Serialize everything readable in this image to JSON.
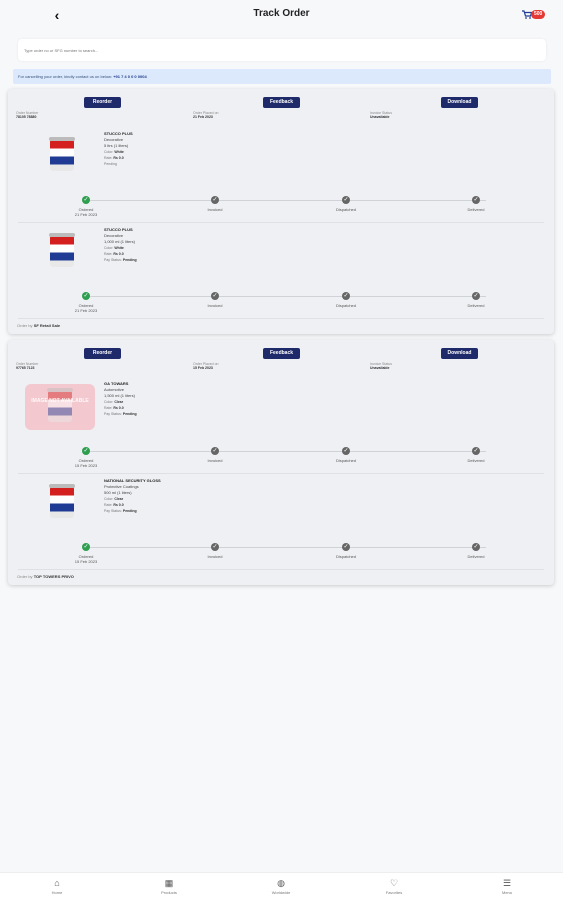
{
  "header": {
    "title": "Track Order",
    "back_icon": "chevron-left-icon",
    "cart_badge": "500"
  },
  "search": {
    "placeholder": "Type order no or SFG number to search..."
  },
  "notice": {
    "text": "For cancelling your order, kindly contact us on below:",
    "phone": "+91 7 4 0 0 0 0004"
  },
  "orders": [
    {
      "buttons": {
        "reorder": "Reorder",
        "feedback": "Feedback",
        "download": "Download"
      },
      "meta": [
        {
          "label": "Order Number",
          "value": "78105 78880"
        },
        {
          "label": "Order Placed on",
          "value": "21 Feb 2023"
        },
        {
          "label": "Invoice Status",
          "value": "Unavailable"
        }
      ],
      "items": [
        {
          "name": "STUCCO PLUS",
          "category": "Decorative",
          "qty": "5 ltrs (1 liters)",
          "color": "White",
          "rate": "Rs 0.0",
          "status_line": "Pending",
          "steps": [
            {
              "label": "Ordered",
              "date": "21 Feb 2023",
              "done": true
            },
            {
              "label": "Invoiced",
              "date": "",
              "done": false
            },
            {
              "label": "Dispatched",
              "date": "",
              "done": false
            },
            {
              "label": "Delivered",
              "date": "",
              "done": false
            }
          ]
        },
        {
          "name": "STUCCO PLUS",
          "category": "Decorative",
          "qty": "1,000 ml (1 liters)",
          "color": "White",
          "rate": "Rs 0.0",
          "status_line": "Pending",
          "steps": [
            {
              "label": "Ordered",
              "date": "21 Feb 2023",
              "done": true
            },
            {
              "label": "Invoiced",
              "date": "",
              "done": false
            },
            {
              "label": "Dispatched",
              "date": "",
              "done": false
            },
            {
              "label": "Delivered",
              "date": "",
              "done": false
            }
          ]
        }
      ],
      "order_by_label": "Order by",
      "order_by": "SF Retail Sale"
    },
    {
      "buttons": {
        "reorder": "Reorder",
        "feedback": "Feedback",
        "download": "Download"
      },
      "meta": [
        {
          "label": "Order Number",
          "value": "97765 7123"
        },
        {
          "label": "Order Placed on",
          "value": "15 Feb 2023"
        },
        {
          "label": "Invoice Status",
          "value": "Unavailable"
        }
      ],
      "items": [
        {
          "name": "GA TOWARS",
          "category": "Automotive",
          "qty": "1,500 ml (1 liters)",
          "color": "Clear",
          "rate": "Rs 0.0",
          "status_line": "Pending",
          "watermark": "IMAGE NOT AVAILABLE",
          "steps": [
            {
              "label": "Ordered",
              "date": "15 Feb 2023",
              "done": true
            },
            {
              "label": "Invoiced",
              "date": "",
              "done": false
            },
            {
              "label": "Dispatched",
              "date": "",
              "done": false
            },
            {
              "label": "Delivered",
              "date": "",
              "done": false
            }
          ]
        },
        {
          "name": "NATIONAL SECURITY GLOSS",
          "category": "Protective Coatings",
          "qty": "500 ml (1 liters)",
          "color": "Clear",
          "rate": "Rs 0.0",
          "status_line": "Pending",
          "steps": [
            {
              "label": "Ordered",
              "date": "15 Feb 2023",
              "done": true
            },
            {
              "label": "Invoiced",
              "date": "",
              "done": false
            },
            {
              "label": "Dispatched",
              "date": "",
              "done": false
            },
            {
              "label": "Delivered",
              "date": "",
              "done": false
            }
          ]
        }
      ],
      "order_by_label": "Order by",
      "order_by": "TOP TOWERS PRIVO"
    }
  ],
  "bottom_nav": [
    {
      "label": "Home",
      "icon": "home-icon"
    },
    {
      "label": "Products",
      "icon": "grid-icon"
    },
    {
      "label": "Worldwide",
      "icon": "globe-icon"
    },
    {
      "label": "Favorites",
      "icon": "heart-icon"
    },
    {
      "label": "Menu",
      "icon": "menu-icon"
    }
  ],
  "colors": {
    "primary": "#1f2a6b",
    "success": "#2e9e4f",
    "notice_bg": "#dce8fb",
    "badge": "#e53935"
  }
}
